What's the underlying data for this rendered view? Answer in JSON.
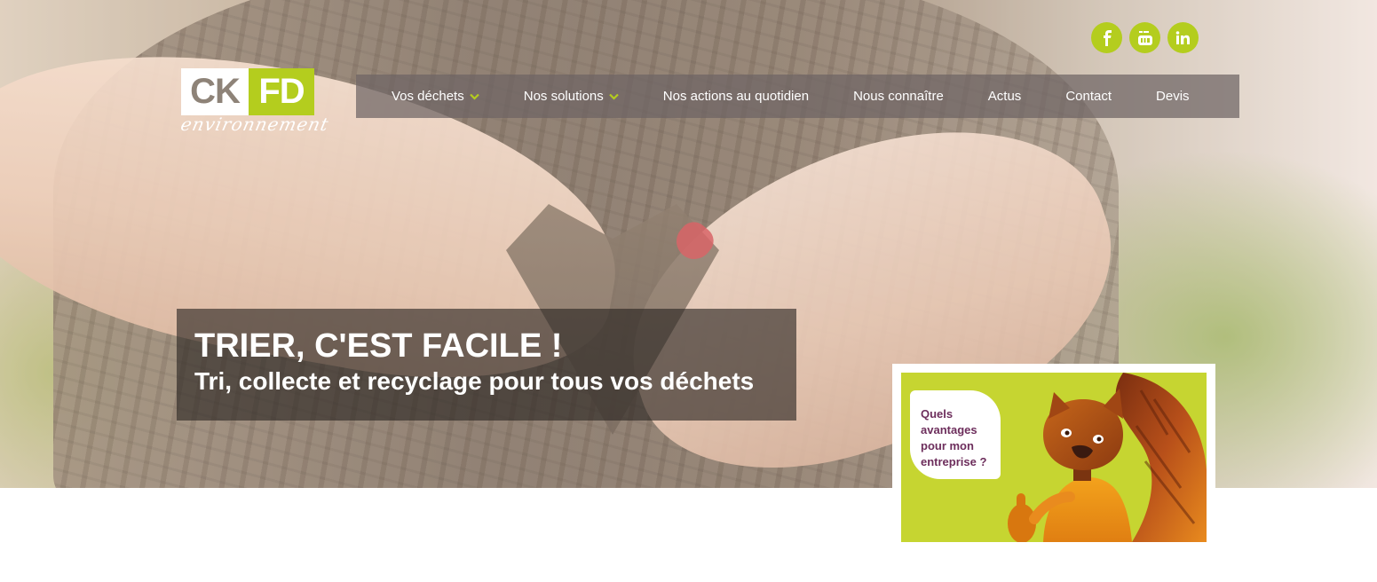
{
  "social": [
    {
      "icon": "facebook-icon",
      "glyph": "f"
    },
    {
      "icon": "youtube-icon",
      "glyph": "You Tube"
    },
    {
      "icon": "linkedin-icon",
      "glyph": "in"
    }
  ],
  "brand": {
    "logo_left": "CK",
    "logo_right": "FD",
    "logo_tagline": "environnement",
    "accent_color": "#b4cd1e",
    "logo_gray": "#8e8378"
  },
  "nav": {
    "items": [
      {
        "label": "Vos déchets",
        "has_dropdown": true
      },
      {
        "label": "Nos solutions",
        "has_dropdown": true
      },
      {
        "label": "Nos actions au quotidien",
        "has_dropdown": false
      },
      {
        "label": "Nous connaître",
        "has_dropdown": false
      },
      {
        "label": "Actus",
        "has_dropdown": false
      },
      {
        "label": "Contact",
        "has_dropdown": false
      },
      {
        "label": "Devis",
        "has_dropdown": false
      }
    ]
  },
  "hero": {
    "title": "TRIER, C'EST FACILE !",
    "subtitle": "Tri, collecte et recyclage pour tous vos déchets"
  },
  "promo": {
    "lines": [
      "Quels",
      "avantages",
      "pour mon",
      "entreprise ?"
    ],
    "text_color": "#6d2e5c",
    "bg_color": "#c6d531"
  }
}
